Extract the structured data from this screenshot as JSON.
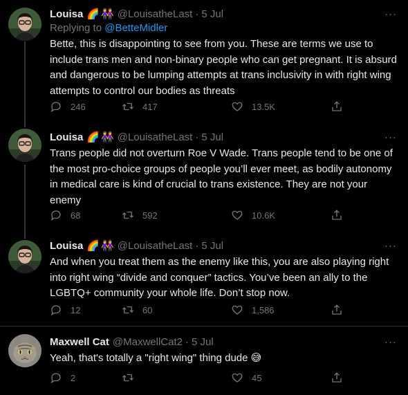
{
  "tweets": [
    {
      "name": "Louisa",
      "emoji": [
        "🌈",
        "👭"
      ],
      "handle": "@LouisatheLast",
      "separator": "·",
      "date": "5 Jul",
      "reply_prefix": "Replying to ",
      "reply_handle": "@BetteMidler",
      "text": "Bette, this is disappointing to see from you. These are terms we use to\ninclude trans men and non-binary people who can get pregnant. It is absurd\nand dangerous to be lumping attempts at trans inclusivity in with right wing\nattempts to control our bodies as threats",
      "replies": "246",
      "retweets": "417",
      "likes": "13.5K"
    },
    {
      "name": "Louisa",
      "emoji": [
        "🌈",
        "👭"
      ],
      "handle": "@LouisatheLast",
      "separator": "·",
      "date": "5 Jul",
      "text": "Trans people did not overturn Roe V Wade. Trans people tend to be one of\nthe most pro-choice groups of people you’ll ever meet, as bodily autonomy\nin medical care is kind of crucial to trans existence. They are not your\nenemy",
      "replies": "68",
      "retweets": "592",
      "likes": "10.6K"
    },
    {
      "name": "Louisa",
      "emoji": [
        "🌈",
        "👭"
      ],
      "handle": "@LouisatheLast",
      "separator": "·",
      "date": "5 Jul",
      "text": "And when you treat them as the enemy like this, you are also playing right\ninto right wing “divide and conquer” tactics. You’ve been an ally to the\nLGBTQ+ community your whole life. Don’t stop now.",
      "replies": "12",
      "retweets": "60",
      "likes": "1,586"
    },
    {
      "name": "Maxwell Cat",
      "handle": "@MaxwellCat2",
      "separator": "·",
      "date": "5 Jul",
      "text": "Yeah, that's totally a \"right wing\" thing dude",
      "text_emoji": "😅",
      "replies": "2",
      "retweets": "",
      "likes": "45"
    }
  ],
  "more_glyph": "···",
  "colors": {
    "background": "#000000",
    "text": "#e7e9ea",
    "muted": "#71767b",
    "link": "#1d9bf0",
    "divider": "#2f3336"
  }
}
